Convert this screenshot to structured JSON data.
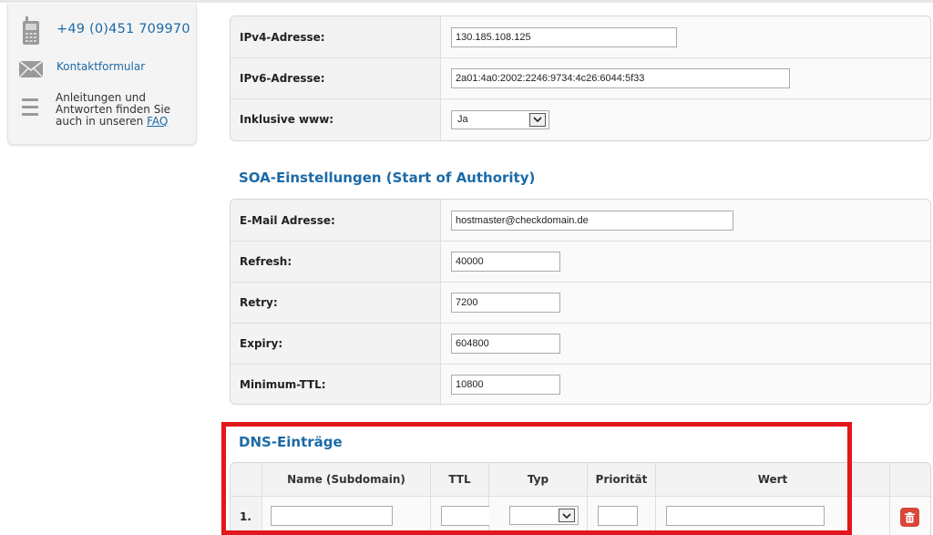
{
  "contact": {
    "phone": "+49 (0)451 709970",
    "contact_form": "Kontaktformular",
    "faq_text": "Anleitungen und Antworten finden Sie auch in unseren",
    "faq_link": "FAQ"
  },
  "ip_settings": {
    "ipv4_label": "IPv4-Adresse:",
    "ipv4_value": "130.185.108.125",
    "ipv6_label": "IPv6-Adresse:",
    "ipv6_value": "2a01:4a0:2002:2246:9734:4c26:6044:5f33",
    "www_label": "Inklusive www:",
    "www_value": "Ja"
  },
  "soa": {
    "title": "SOA-Einstellungen (Start of Authority)",
    "email_label": "E-Mail Adresse:",
    "email_value": "hostmaster@checkdomain.de",
    "refresh_label": "Refresh:",
    "refresh_value": "40000",
    "retry_label": "Retry:",
    "retry_value": "7200",
    "expiry_label": "Expiry:",
    "expiry_value": "604800",
    "minttl_label": "Minimum-TTL:",
    "minttl_value": "10800"
  },
  "dns": {
    "title": "DNS-Einträge",
    "columns": [
      "Name (Subdomain)",
      "TTL",
      "Typ",
      "Priorität",
      "Wert"
    ],
    "row_number": "1."
  },
  "colors": {
    "accent": "#1c6aa6",
    "highlight_frame": "#e3161d",
    "delete": "#d9463a"
  }
}
